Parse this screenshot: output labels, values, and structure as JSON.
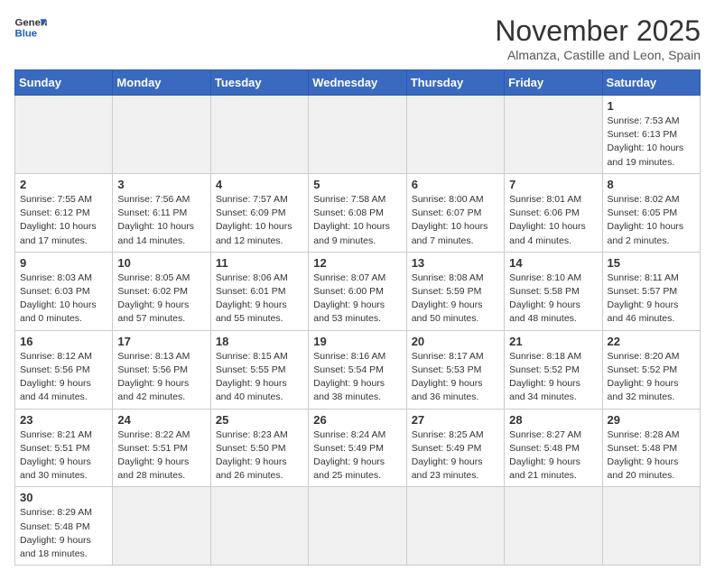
{
  "header": {
    "logo_line1": "General",
    "logo_line2": "Blue",
    "month_year": "November 2025",
    "location": "Almanza, Castille and Leon, Spain"
  },
  "weekdays": [
    "Sunday",
    "Monday",
    "Tuesday",
    "Wednesday",
    "Thursday",
    "Friday",
    "Saturday"
  ],
  "weeks": [
    [
      {
        "day": "",
        "info": ""
      },
      {
        "day": "",
        "info": ""
      },
      {
        "day": "",
        "info": ""
      },
      {
        "day": "",
        "info": ""
      },
      {
        "day": "",
        "info": ""
      },
      {
        "day": "",
        "info": ""
      },
      {
        "day": "1",
        "info": "Sunrise: 7:53 AM\nSunset: 6:13 PM\nDaylight: 10 hours and 19 minutes."
      }
    ],
    [
      {
        "day": "2",
        "info": "Sunrise: 7:55 AM\nSunset: 6:12 PM\nDaylight: 10 hours and 17 minutes."
      },
      {
        "day": "3",
        "info": "Sunrise: 7:56 AM\nSunset: 6:11 PM\nDaylight: 10 hours and 14 minutes."
      },
      {
        "day": "4",
        "info": "Sunrise: 7:57 AM\nSunset: 6:09 PM\nDaylight: 10 hours and 12 minutes."
      },
      {
        "day": "5",
        "info": "Sunrise: 7:58 AM\nSunset: 6:08 PM\nDaylight: 10 hours and 9 minutes."
      },
      {
        "day": "6",
        "info": "Sunrise: 8:00 AM\nSunset: 6:07 PM\nDaylight: 10 hours and 7 minutes."
      },
      {
        "day": "7",
        "info": "Sunrise: 8:01 AM\nSunset: 6:06 PM\nDaylight: 10 hours and 4 minutes."
      },
      {
        "day": "8",
        "info": "Sunrise: 8:02 AM\nSunset: 6:05 PM\nDaylight: 10 hours and 2 minutes."
      }
    ],
    [
      {
        "day": "9",
        "info": "Sunrise: 8:03 AM\nSunset: 6:03 PM\nDaylight: 10 hours and 0 minutes."
      },
      {
        "day": "10",
        "info": "Sunrise: 8:05 AM\nSunset: 6:02 PM\nDaylight: 9 hours and 57 minutes."
      },
      {
        "day": "11",
        "info": "Sunrise: 8:06 AM\nSunset: 6:01 PM\nDaylight: 9 hours and 55 minutes."
      },
      {
        "day": "12",
        "info": "Sunrise: 8:07 AM\nSunset: 6:00 PM\nDaylight: 9 hours and 53 minutes."
      },
      {
        "day": "13",
        "info": "Sunrise: 8:08 AM\nSunset: 5:59 PM\nDaylight: 9 hours and 50 minutes."
      },
      {
        "day": "14",
        "info": "Sunrise: 8:10 AM\nSunset: 5:58 PM\nDaylight: 9 hours and 48 minutes."
      },
      {
        "day": "15",
        "info": "Sunrise: 8:11 AM\nSunset: 5:57 PM\nDaylight: 9 hours and 46 minutes."
      }
    ],
    [
      {
        "day": "16",
        "info": "Sunrise: 8:12 AM\nSunset: 5:56 PM\nDaylight: 9 hours and 44 minutes."
      },
      {
        "day": "17",
        "info": "Sunrise: 8:13 AM\nSunset: 5:56 PM\nDaylight: 9 hours and 42 minutes."
      },
      {
        "day": "18",
        "info": "Sunrise: 8:15 AM\nSunset: 5:55 PM\nDaylight: 9 hours and 40 minutes."
      },
      {
        "day": "19",
        "info": "Sunrise: 8:16 AM\nSunset: 5:54 PM\nDaylight: 9 hours and 38 minutes."
      },
      {
        "day": "20",
        "info": "Sunrise: 8:17 AM\nSunset: 5:53 PM\nDaylight: 9 hours and 36 minutes."
      },
      {
        "day": "21",
        "info": "Sunrise: 8:18 AM\nSunset: 5:52 PM\nDaylight: 9 hours and 34 minutes."
      },
      {
        "day": "22",
        "info": "Sunrise: 8:20 AM\nSunset: 5:52 PM\nDaylight: 9 hours and 32 minutes."
      }
    ],
    [
      {
        "day": "23",
        "info": "Sunrise: 8:21 AM\nSunset: 5:51 PM\nDaylight: 9 hours and 30 minutes."
      },
      {
        "day": "24",
        "info": "Sunrise: 8:22 AM\nSunset: 5:51 PM\nDaylight: 9 hours and 28 minutes."
      },
      {
        "day": "25",
        "info": "Sunrise: 8:23 AM\nSunset: 5:50 PM\nDaylight: 9 hours and 26 minutes."
      },
      {
        "day": "26",
        "info": "Sunrise: 8:24 AM\nSunset: 5:49 PM\nDaylight: 9 hours and 25 minutes."
      },
      {
        "day": "27",
        "info": "Sunrise: 8:25 AM\nSunset: 5:49 PM\nDaylight: 9 hours and 23 minutes."
      },
      {
        "day": "28",
        "info": "Sunrise: 8:27 AM\nSunset: 5:48 PM\nDaylight: 9 hours and 21 minutes."
      },
      {
        "day": "29",
        "info": "Sunrise: 8:28 AM\nSunset: 5:48 PM\nDaylight: 9 hours and 20 minutes."
      }
    ],
    [
      {
        "day": "30",
        "info": "Sunrise: 8:29 AM\nSunset: 5:48 PM\nDaylight: 9 hours and 18 minutes."
      },
      {
        "day": "",
        "info": ""
      },
      {
        "day": "",
        "info": ""
      },
      {
        "day": "",
        "info": ""
      },
      {
        "day": "",
        "info": ""
      },
      {
        "day": "",
        "info": ""
      },
      {
        "day": "",
        "info": ""
      }
    ]
  ]
}
